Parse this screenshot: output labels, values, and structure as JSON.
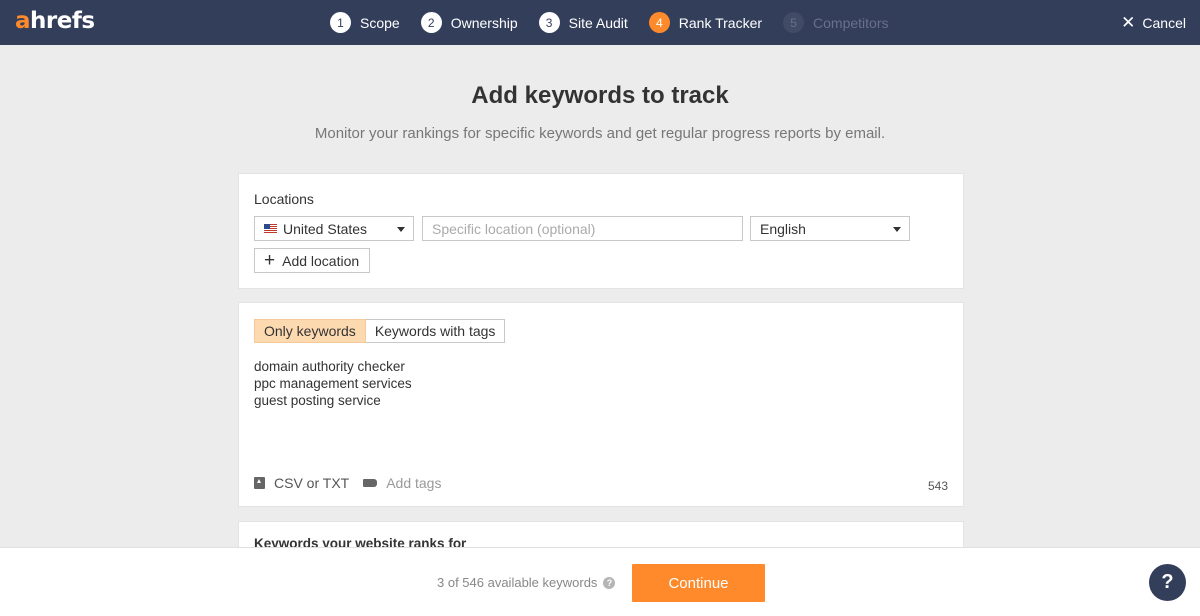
{
  "app": {
    "logo_first": "a",
    "logo_rest": "hrefs"
  },
  "steps": [
    {
      "num": "1",
      "label": "Scope"
    },
    {
      "num": "2",
      "label": "Ownership"
    },
    {
      "num": "3",
      "label": "Site Audit"
    },
    {
      "num": "4",
      "label": "Rank Tracker"
    },
    {
      "num": "5",
      "label": "Competitors"
    }
  ],
  "active_step": 4,
  "cancel_label": "Cancel",
  "header": {
    "title": "Add keywords to track",
    "subtitle": "Monitor your rankings for specific keywords and get regular progress reports by email."
  },
  "locations": {
    "label": "Locations",
    "country": "United States",
    "specific_placeholder": "Specific location (optional)",
    "language": "English",
    "add_location_label": "Add location"
  },
  "keywords": {
    "toggle_options": [
      "Only keywords",
      "Keywords with tags"
    ],
    "selected_option": "Only keywords",
    "lines": [
      "domain authority checker",
      "ppc management services",
      "guest posting service"
    ],
    "upload_label": "CSV or TXT",
    "add_tags_label": "Add tags",
    "char_count": "543"
  },
  "ranks_section": {
    "title": "Keywords your website ranks for"
  },
  "footer": {
    "available_text": "3 of 546 available keywords",
    "continue_label": "Continue"
  },
  "help_label": "?",
  "colors": {
    "accent": "#ff8a2b",
    "nav_bg": "#333e5b",
    "toggle_selected": "#fdd9b0"
  }
}
